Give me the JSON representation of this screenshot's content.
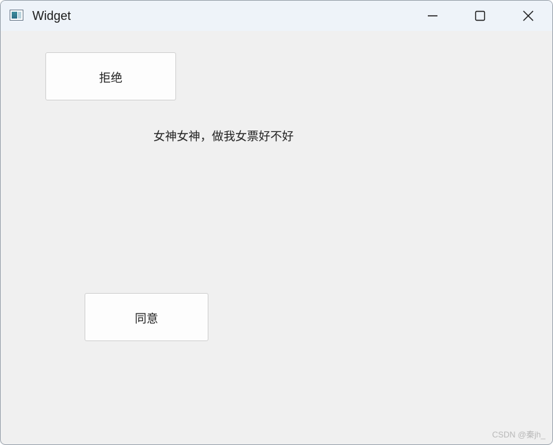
{
  "window": {
    "title": "Widget"
  },
  "buttons": {
    "reject_label": "拒绝",
    "agree_label": "同意"
  },
  "content": {
    "message": "女神女神，做我女票好不好"
  },
  "watermark": "CSDN @秦jh_",
  "icons": {
    "app": "app-window-icon",
    "minimize": "minimize-icon",
    "maximize": "maximize-icon",
    "close": "close-icon"
  }
}
